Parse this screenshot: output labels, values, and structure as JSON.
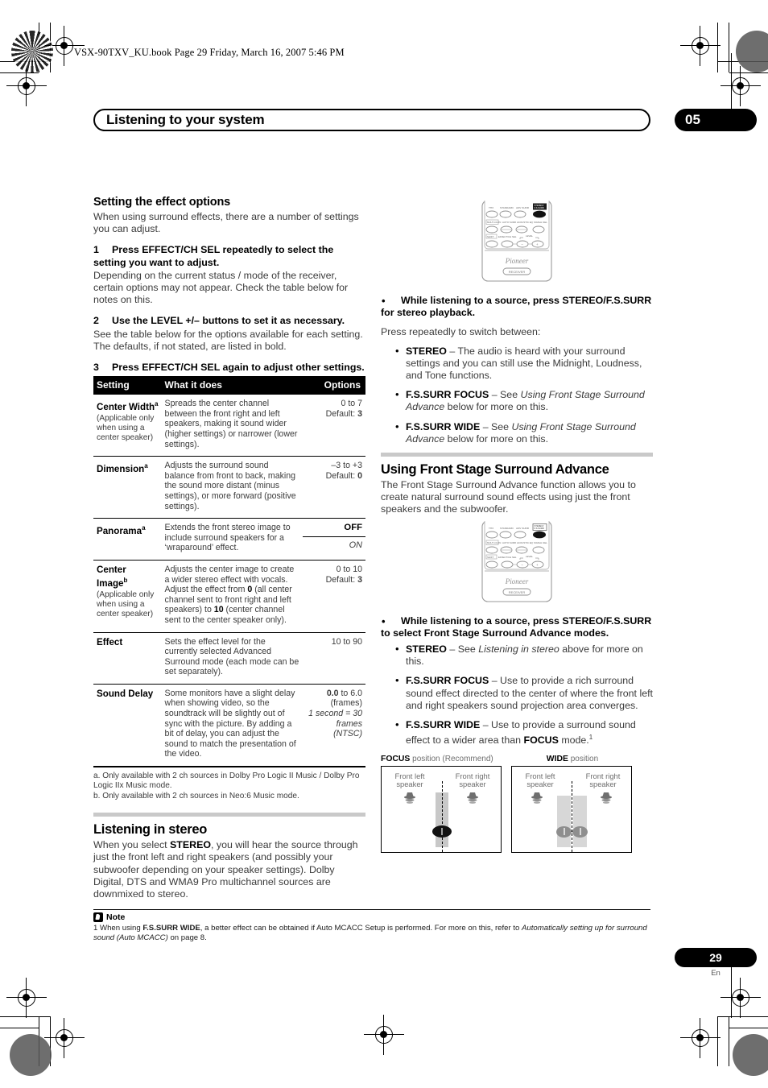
{
  "book_header": "VSX-90TXV_KU.book  Page 29  Friday, March 16, 2007  5:46 PM",
  "chapter": {
    "title": "Listening to your system",
    "number": "05"
  },
  "left_column": {
    "section1_title": "Setting the effect options",
    "section1_intro": "When using surround effects, there are a number of settings you can adjust.",
    "steps": [
      {
        "no": "1",
        "heading": "Press EFFECT/CH SEL repeatedly to select the setting you want to adjust.",
        "body": "Depending on the current status / mode of the receiver, certain options may not appear. Check the table below for notes on this."
      },
      {
        "no": "2",
        "heading": "Use the LEVEL +/– buttons to set it as necessary.",
        "body": "See the table below for the options available for each setting. The defaults, if not stated, are listed in bold."
      },
      {
        "no": "3",
        "heading": "Press EFFECT/CH SEL again to adjust other settings.",
        "body": ""
      }
    ],
    "table": {
      "headers": [
        "Setting",
        "What it does",
        "Options"
      ],
      "rows": [
        {
          "setting_name": "Center Width",
          "setting_sup": "a",
          "setting_note": "(Applicable only when using a center speaker)",
          "description": "Spreads the center channel between the front right and left speakers, making it sound wider (higher settings) or narrower (lower settings).",
          "options_range": "0 to 7",
          "options_default_label": "Default: ",
          "options_default": "3"
        },
        {
          "setting_name": "Dimension",
          "setting_sup": "a",
          "setting_note": "",
          "description": "Adjusts the surround sound balance from front to back, making the sound more distant (minus settings), or more forward (positive settings).",
          "options_range": "–3 to +3",
          "options_default_label": "Default: ",
          "options_default": "0"
        },
        {
          "setting_name": "Panorama",
          "setting_sup": "a",
          "setting_note": "",
          "description": "Extends the front stereo image to include surround speakers for a ‘wraparound’ effect.",
          "options_off": "OFF",
          "options_on": "ON"
        },
        {
          "setting_name": "Center Image",
          "setting_sup": "b",
          "setting_note": "(Applicable only when using a center speaker)",
          "description_pre": "Adjusts the center image to create a wider stereo effect with vocals. Adjust the effect from ",
          "description_b1": "0",
          "description_mid": " (all center channel sent to front right and left speakers) to ",
          "description_b2": "10",
          "description_post": " (center channel sent to the center speaker only).",
          "options_range": "0 to 10",
          "options_default_label": "Default: ",
          "options_default": "3"
        },
        {
          "setting_name": "Effect",
          "setting_sup": "",
          "setting_note": "",
          "description": "Sets the effect level for the currently selected Advanced Surround mode (each mode can be set separately).",
          "options_range": "10 to 90",
          "options_default_label": "",
          "options_default": ""
        },
        {
          "setting_name": "Sound Delay",
          "setting_sup": "",
          "setting_note": "",
          "description": "Some monitors have a slight delay when showing video, so the soundtrack will be slightly out of sync with the picture. By adding a bit of delay, you can adjust the sound to match the presentation of the video.",
          "options_bold": "0.0",
          "options_rest": " to 6.0",
          "options_frames": "(frames)",
          "options_italic": "1 second = 30 frames (NTSC)"
        }
      ],
      "footnotes": [
        "a. Only available with 2 ch sources in Dolby Pro Logic II Music / Dolby Pro Logic IIx Music mode.",
        "b. Only available with 2 ch sources in Neo:6 Music mode."
      ]
    },
    "section2_title": "Listening in stereo",
    "section2_body_pre": "When you select ",
    "section2_body_bold": "STEREO",
    "section2_body_post": ", you will hear the source through just the front left and right speakers (and possibly your subwoofer depending on your speaker settings). Dolby Digital, DTS and WMA9 Pro multichannel sources are downmixed to stereo."
  },
  "right_column": {
    "remote_top": {
      "brand": "Pioneer",
      "mode_label": "RECEIVER",
      "row1_labels": [
        "THX",
        "STANDARD",
        "ADV SURR",
        "STEREO/ F.S.SURR"
      ],
      "row2_labels": [
        "MULTI-CH IN",
        "AUTO SURR",
        "ACOUSTIC EQ",
        "SIGNAL SEL"
      ],
      "row3_labels": [
        "SHIFT",
        "EFFECT/CH SEL",
        "LEVEL",
        "–",
        "+"
      ]
    },
    "bullet_stereo": {
      "heading": "While listening to a source, press STEREO/F.S.SURR for stereo playback.",
      "intro": "Press repeatedly to switch between:",
      "items": [
        {
          "term": "STEREO",
          "dash": " – ",
          "text": "The audio is heard with your surround settings and you can still use the Midnight, Loudness, and Tone functions.",
          "italic": ""
        },
        {
          "term": "F.S.SURR FOCUS",
          "dash": " – ",
          "text_pre": "See ",
          "italic": "Using Front Stage Surround Advance",
          "text_post": " below for more on this."
        },
        {
          "term": "F.S.SURR WIDE",
          "dash": " – ",
          "text_pre": "See ",
          "italic": "Using Front Stage Surround Advance",
          "text_post": " below for more on this."
        }
      ]
    },
    "section_fssa_title": "Using Front Stage Surround Advance",
    "section_fssa_body": "The Front Stage Surround Advance function allows you to create natural surround sound effects using just the front speakers and the subwoofer.",
    "bullet_fssa": {
      "heading": "While listening to a source, press STEREO/F.S.SURR to select Front Stage Surround Advance modes.",
      "items": [
        {
          "term": "STEREO",
          "dash": " – ",
          "text_pre": "See ",
          "italic": "Listening in stereo",
          "text_post": " above for more on this."
        },
        {
          "term": "F.S.SURR FOCUS",
          "dash": " – ",
          "text_pre": "Use to provide a rich surround sound effect directed to the center of where the front left and right speakers sound projection area converges.",
          "italic": "",
          "text_post": ""
        },
        {
          "term": "F.S.SURR WIDE",
          "dash": " – ",
          "text_pre": "Use to provide a surround sound effect to a wider area than ",
          "bold2": "FOCUS",
          "text_post": " mode.",
          "sup": "1"
        }
      ]
    },
    "diagrams": [
      {
        "caption_bold": "FOCUS",
        "caption_rest": " position (Recommend)",
        "left_speaker": "Front left speaker",
        "right_speaker": "Front right speaker"
      },
      {
        "caption_bold": "WIDE",
        "caption_rest": " position",
        "left_speaker": "Front left speaker",
        "right_speaker": "Front right speaker"
      }
    ]
  },
  "note": {
    "label": "Note",
    "marker": "1",
    "text_pre": " When using ",
    "bold1": "F.S.SURR WIDE",
    "text_mid": ", a better effect can be obtained if Auto MCACC Setup is performed. For more on this, refer to ",
    "italic1": "Automatically setting up for surround sound (Auto MCACC)",
    "text_post": " on page 8."
  },
  "footer": {
    "page_number": "29",
    "language": "En"
  },
  "colors": {
    "ink": "#000000",
    "body_text": "#3b3b3b",
    "grey_rule": "#c9c9c9",
    "diagram_bar": "#c8c8c8"
  }
}
